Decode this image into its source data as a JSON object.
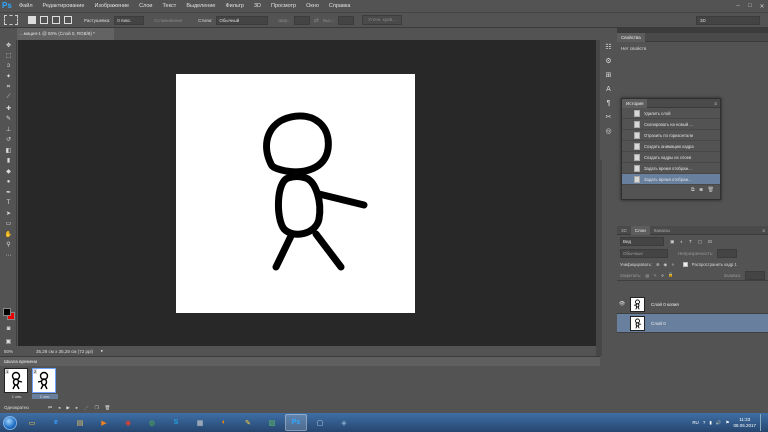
{
  "menubar": {
    "logo": "Ps",
    "items": [
      "Файл",
      "Редактирование",
      "Изображение",
      "Слои",
      "Текст",
      "Выделение",
      "Фильтр",
      "3D",
      "Просмотр",
      "Окно",
      "Справка"
    ],
    "window_controls": [
      "–",
      "□",
      "✕"
    ]
  },
  "options_bar": {
    "feather_label": "Растушевка:",
    "feather_value": "0 пикс.",
    "antialias_label": "Сглаживание",
    "style_label": "Стили:",
    "style_value": "Обычный",
    "width_label": "Шир.:",
    "height_label": "Выс.:",
    "refine_button": "Уточн. край...",
    "workspace": "3D"
  },
  "document": {
    "tab_title": "...мация-1 @ 50% (Слой 0, RGB/8) *",
    "zoom": "50%",
    "doc_info": "35,28 см x 35,28 см (72 ppi)"
  },
  "timeline": {
    "title": "Шкала времени",
    "frames": [
      {
        "number": "1",
        "delay": "1 сек."
      },
      {
        "number": "2",
        "delay": "1 сек."
      }
    ],
    "loop": "Однократно"
  },
  "properties": {
    "tab": "Свойства",
    "empty_text": "Нет свойств"
  },
  "history": {
    "tab": "История",
    "items": [
      "Удалить слой",
      "Скопировать на новый ...",
      "Отразить по горизонтали",
      "Создать анимацию кадра",
      "Создать кадры из слоев",
      "Задать время отображ...",
      "Задать время отображ..."
    ]
  },
  "layers": {
    "tabs": [
      "3D",
      "Слои",
      "Каналы"
    ],
    "kind_filter": "Вид",
    "blend_mode": "Обычные",
    "opacity_label": "Непрозрачность:",
    "unify_label": "Унифицировать:",
    "propagate_label": "Распространить кадр 1",
    "lock_label": "Закрепить:",
    "fill_label": "Заливка:",
    "items": [
      {
        "name": "Слой 0 копия",
        "visible": true
      },
      {
        "name": "Слой 0",
        "visible": false
      }
    ]
  },
  "taskbar": {
    "apps": [
      {
        "icon": "folder-icon",
        "glyph": "▭",
        "color": "#f5c542"
      },
      {
        "icon": "ie-icon",
        "glyph": "e",
        "color": "#3aa0ff"
      },
      {
        "icon": "explorer-icon",
        "glyph": "▤",
        "color": "#f0c060"
      },
      {
        "icon": "media-icon",
        "glyph": "▶",
        "color": "#f08020"
      },
      {
        "icon": "chrome-icon",
        "glyph": "◉",
        "color": "#e04030"
      },
      {
        "icon": "globe-icon",
        "glyph": "◍",
        "color": "#50b050"
      },
      {
        "icon": "skype-icon",
        "glyph": "S",
        "color": "#20a0e0"
      },
      {
        "icon": "calc-icon",
        "glyph": "▦",
        "color": "#cfcfcf"
      },
      {
        "icon": "firefox-icon",
        "glyph": "◐",
        "color": "#ff8a00"
      },
      {
        "icon": "paint-icon",
        "glyph": "✎",
        "color": "#ffd040"
      },
      {
        "icon": "images-icon",
        "glyph": "▨",
        "color": "#60c060"
      },
      {
        "icon": "photoshop-icon",
        "glyph": "Ps",
        "color": "#31a8ff",
        "active": true
      },
      {
        "icon": "window-icon",
        "glyph": "▢",
        "color": "#c0d8f0"
      },
      {
        "icon": "app-icon",
        "glyph": "◈",
        "color": "#8ac"
      }
    ],
    "language": "RU",
    "time": "11:33",
    "date": "08.06.2017"
  }
}
